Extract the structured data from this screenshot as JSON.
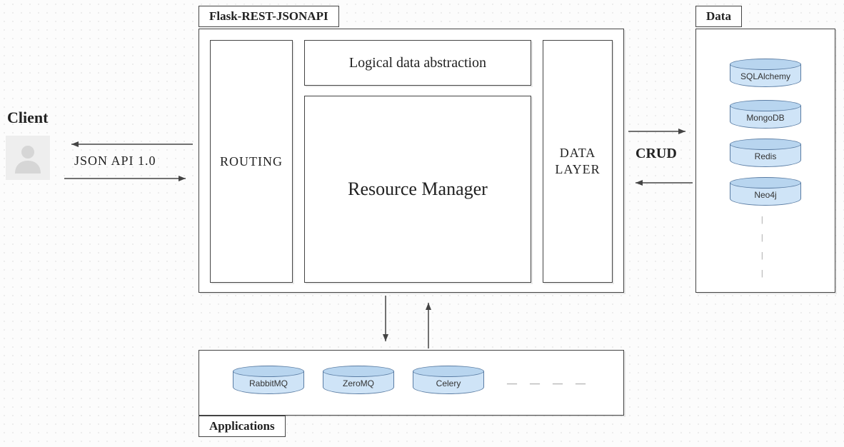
{
  "client": {
    "label": "Client"
  },
  "api": {
    "label": "JSON API 1.0"
  },
  "crud": {
    "label": "CRUD"
  },
  "framework": {
    "title": "Flask-REST-JSONAPI",
    "routing": "ROUTING",
    "logical": "Logical data abstraction",
    "resource": "Resource Manager",
    "datalayer": "DATA LAYER"
  },
  "data": {
    "title": "Data",
    "stores": [
      "SQLAlchemy",
      "MongoDB",
      "Redis",
      "Neo4j"
    ]
  },
  "applications": {
    "title": "Applications",
    "apps": [
      "RabbitMQ",
      "ZeroMQ",
      "Celery"
    ]
  }
}
